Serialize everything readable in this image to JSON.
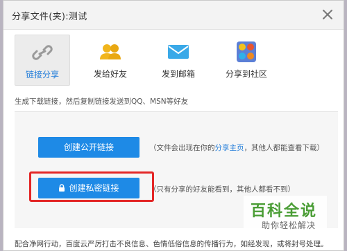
{
  "window": {
    "title": "分享文件(夹):测试"
  },
  "tabs": [
    {
      "label": "链接分享",
      "icon": "link-icon",
      "active": true
    },
    {
      "label": "发给好友",
      "icon": "friends-icon",
      "active": false
    },
    {
      "label": "发到邮箱",
      "icon": "mail-icon",
      "active": false
    },
    {
      "label": "分享到社区",
      "icon": "community-icon",
      "active": false
    }
  ],
  "hint": "生成下载链接，然后复制链接发送到QQ、MSN等好友",
  "public_link": {
    "button_label": "创建公开链接",
    "note_before": "（文件会出现在你的",
    "note_link": "分享主页",
    "note_after": "，其他人都能查看下载）"
  },
  "private_link": {
    "button_label": "创建私密链接",
    "note": "（只有分享的好友能看到，其他人都看不到）"
  },
  "footer": "配合净网行动，百度云严厉打击不良信息、色情低俗信息的传播行为，如经发现，或将封号处理。",
  "watermark": {
    "title": "百科全说",
    "subtitle": "助你轻松解决"
  },
  "colors": {
    "accent": "#1e8ae6",
    "highlight": "#e32626",
    "watermark_green": "#4a9d35"
  }
}
